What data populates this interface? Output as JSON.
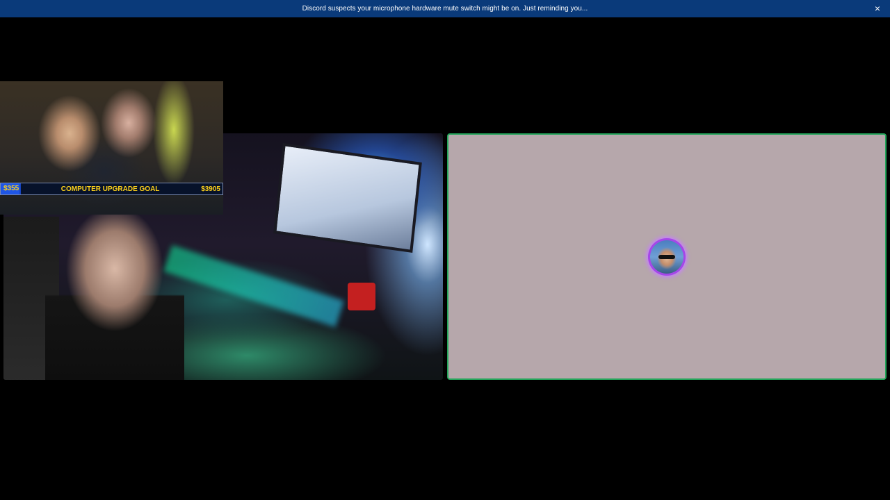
{
  "notice": {
    "message": "Discord suspects your microphone hardware mute switch might be on. Just reminding you...",
    "close_icon": "×"
  },
  "donation_goal": {
    "current": "$355",
    "title": "COMPUTER UPGRADE GOAL",
    "target": "$3905",
    "progress_fraction": 0.09
  },
  "colors": {
    "notice_bg": "#0a3a7a",
    "speaking_border": "#23a55a",
    "avatar_ring": "#a547e8",
    "goal_text": "#ffd21a",
    "voice_tile_bg": "#b6a7ab"
  }
}
